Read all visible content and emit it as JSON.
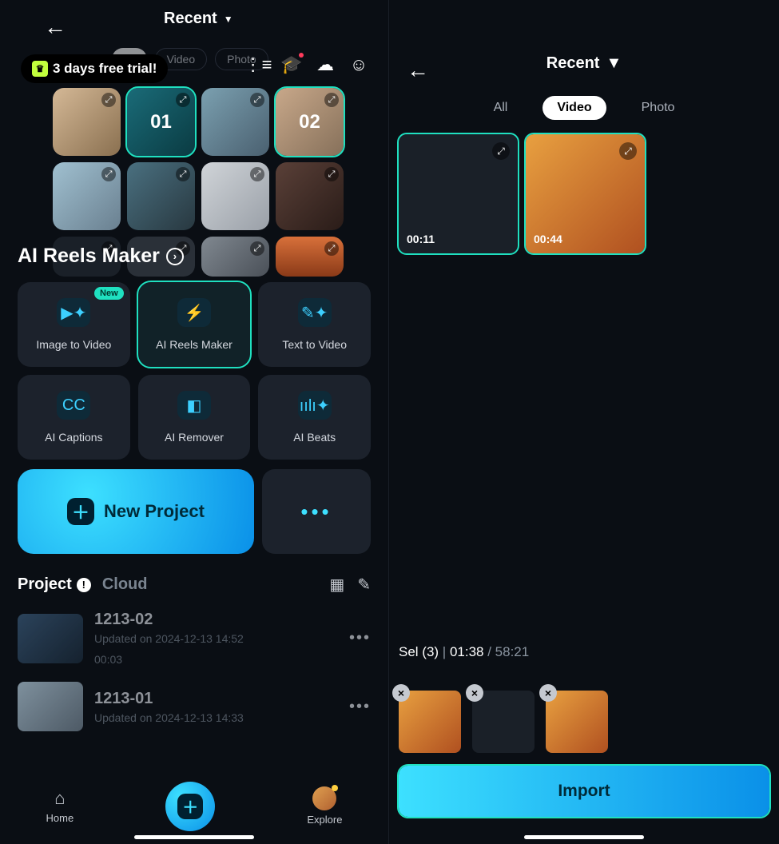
{
  "left": {
    "recent": "Recent",
    "trial": "3 days free trial!",
    "filters": {
      "all": "All",
      "video": "Video",
      "photo": "Photo"
    },
    "media_overlays": {
      "t1": "01",
      "t3": "02"
    },
    "section_title": "AI Reels Maker",
    "ai": {
      "image_to_video": "Image to Video",
      "reels": "AI Reels Maker",
      "text_to_video": "Text  to Video",
      "captions": "AI Captions",
      "remover": "AI Remover",
      "beats": "AI Beats",
      "badge_new": "New"
    },
    "new_project": "New Project",
    "tabs": {
      "project": "Project",
      "cloud": "Cloud"
    },
    "projects": [
      {
        "title": "1213-02",
        "updated": "Updated on 2024-12-13 14:52",
        "dur": "00:03"
      },
      {
        "title": "1213-01",
        "updated": "Updated on 2024-12-13 14:33",
        "dur": ""
      }
    ],
    "nav": {
      "home": "Home",
      "explore": "Explore"
    }
  },
  "right": {
    "recent": "Recent",
    "filters": {
      "all": "All",
      "video": "Video",
      "photo": "Photo"
    },
    "tiles": [
      {
        "dur": "00:11"
      },
      {
        "dur": "00:44"
      }
    ],
    "sel_label": "Sel (3)",
    "sel_sep": " | ",
    "sel_time": "01:38",
    "sel_total": " / 58:21",
    "import": "Import"
  }
}
